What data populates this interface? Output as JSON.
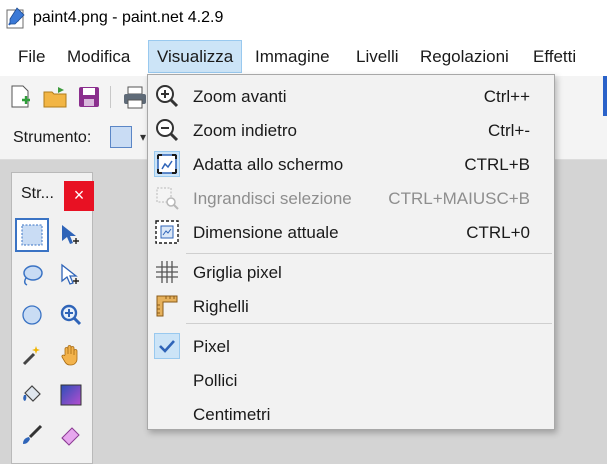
{
  "window": {
    "title": "paint4.png - paint.net 4.2.9"
  },
  "menubar": {
    "items": [
      {
        "label": "File"
      },
      {
        "label": "Modifica"
      },
      {
        "label": "Visualizza"
      },
      {
        "label": "Immagine"
      },
      {
        "label": "Livelli"
      },
      {
        "label": "Regolazioni"
      },
      {
        "label": "Effetti"
      }
    ]
  },
  "toolbar": {
    "tool_label": "Strumento:"
  },
  "tools_window": {
    "title": "Str...",
    "close": "×"
  },
  "view_menu": {
    "items": [
      {
        "label": "Zoom avanti",
        "shortcut": "Ctrl++",
        "icon": "zoom-in-icon",
        "enabled": true
      },
      {
        "label": "Zoom indietro",
        "shortcut": "Ctrl+-",
        "icon": "zoom-out-icon",
        "enabled": true
      },
      {
        "label": "Adatta allo schermo",
        "shortcut": "CTRL+B",
        "icon": "fit-screen-icon",
        "enabled": true
      },
      {
        "label": "Ingrandisci selezione",
        "shortcut": "CTRL+MAIUSC+B",
        "icon": "zoom-selection-icon",
        "enabled": false
      },
      {
        "label": "Dimensione attuale",
        "shortcut": "CTRL+0",
        "icon": "actual-size-icon",
        "enabled": true
      },
      {
        "label": "Griglia pixel",
        "shortcut": "",
        "icon": "pixel-grid-icon",
        "enabled": true
      },
      {
        "label": "Righelli",
        "shortcut": "",
        "icon": "rulers-icon",
        "enabled": true
      },
      {
        "label": "Pixel",
        "shortcut": "",
        "icon": "check-icon",
        "enabled": true,
        "checked": true
      },
      {
        "label": "Pollici",
        "shortcut": "",
        "icon": "",
        "enabled": true
      },
      {
        "label": "Centimetri",
        "shortcut": "",
        "icon": "",
        "enabled": true
      }
    ]
  },
  "colors": {
    "accent": "#3a73c4",
    "menu_highlight": "#cce4f7",
    "close_red": "#e81123"
  }
}
